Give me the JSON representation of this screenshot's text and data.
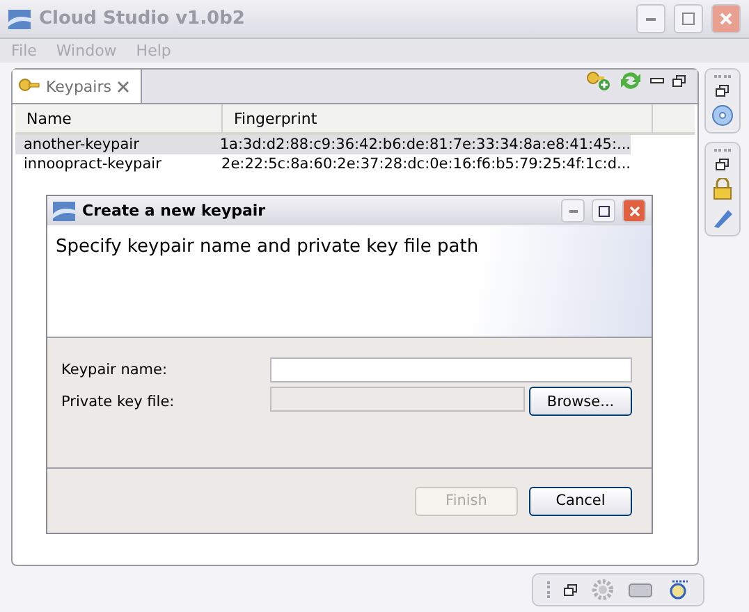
{
  "window": {
    "title": "Cloud Studio v1.0b2",
    "active": false
  },
  "menu": [
    "File",
    "Window",
    "Help"
  ],
  "view": {
    "tab": {
      "label": "Keypairs",
      "selected": true
    },
    "table": {
      "columns": [
        "Name",
        "Fingerprint"
      ],
      "rows": [
        {
          "name": "another-keypair",
          "fingerprint": "1a:3d:d2:88:c9:36:42:b6:de:81:7e:33:34:8a:e8:41:45:...",
          "selected": true
        },
        {
          "name": "innoopract-keypair",
          "fingerprint": "2e:22:5c:8a:60:2e:37:28:dc:0e:16:f6:b5:79:25:4f:1c:d...",
          "selected": false
        }
      ]
    }
  },
  "dialog": {
    "title": "Create a new keypair",
    "heading": "Specify keypair name and private key file path",
    "fields": [
      {
        "label": "Keypair name:",
        "disabled": false
      },
      {
        "label": "Private key file:",
        "disabled": true
      }
    ],
    "browse": "Browse...",
    "buttons": [
      {
        "label": "Finish",
        "disabled": true
      },
      {
        "label": "Cancel",
        "disabled": false
      }
    ]
  }
}
